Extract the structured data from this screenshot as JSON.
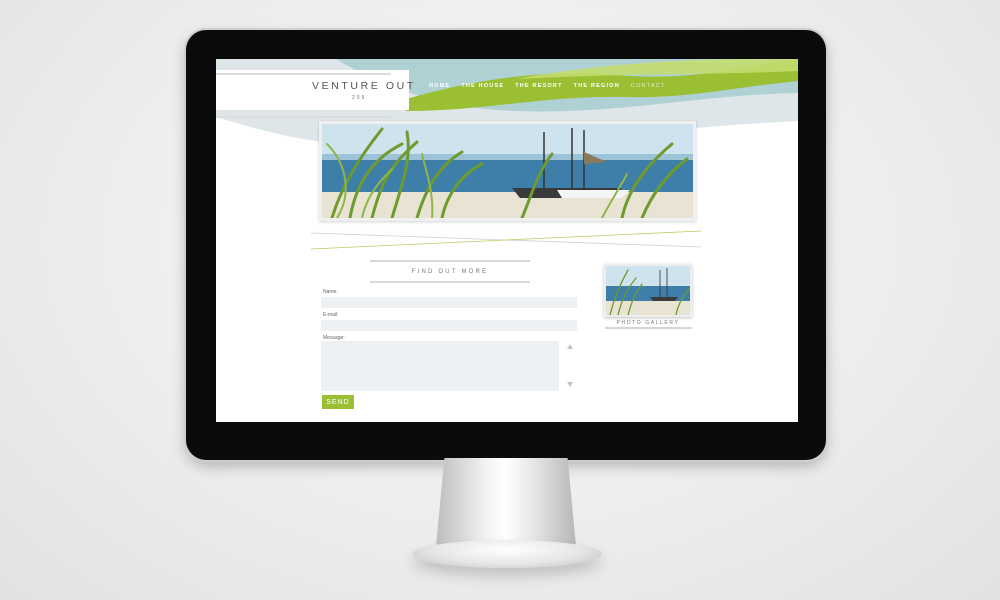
{
  "site": {
    "title": "VENTURE OUT",
    "subtitle": "209"
  },
  "nav": {
    "items": [
      {
        "label": "HOME"
      },
      {
        "label": "THE HOUSE"
      },
      {
        "label": "THE RESORT"
      },
      {
        "label": "THE REGION"
      },
      {
        "label": "CONTACT"
      }
    ]
  },
  "form": {
    "heading": "FIND OUT MORE",
    "name_label": "Name:",
    "email_label": "E-mail:",
    "message_label": "Message:",
    "send_label": "SEND"
  },
  "gallery": {
    "label": "PHOTO GALLERY"
  },
  "colors": {
    "accent_green": "#9bbf33",
    "wave_teal": "#a8cdd0",
    "wave_gray": "#dfe6e9"
  },
  "icons": {
    "scroll_up": "triangle-up",
    "scroll_down": "triangle-down"
  }
}
